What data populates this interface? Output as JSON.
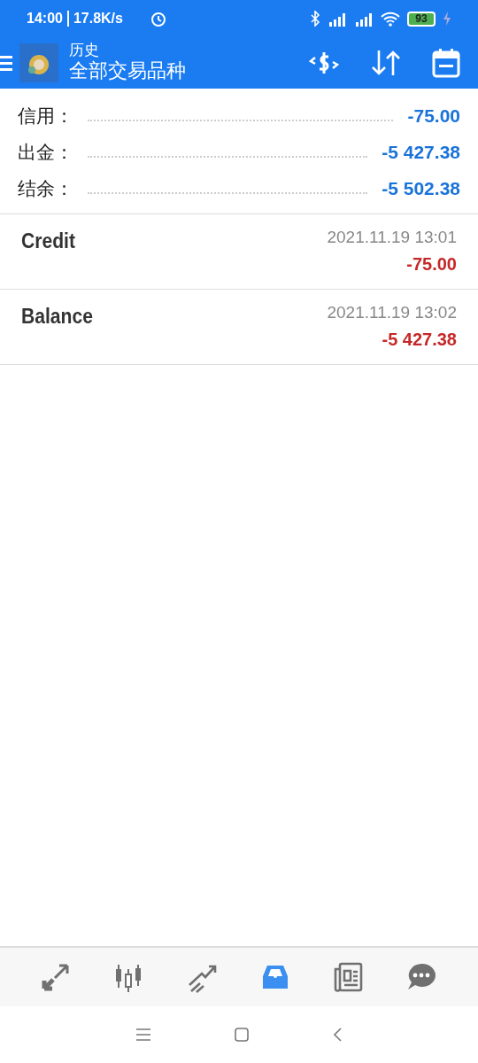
{
  "status_bar": {
    "time": "14:00",
    "speed": "17.8K/s",
    "battery": "93"
  },
  "toolbar": {
    "title": "历史",
    "subtitle": "全部交易品种"
  },
  "summary": [
    {
      "label": "信用：",
      "value": "-75.00"
    },
    {
      "label": "出金：",
      "value": "-5 427.38"
    },
    {
      "label": "结余：",
      "value": "-5 502.38"
    }
  ],
  "deals": [
    {
      "type": "Credit",
      "time": "2021.11.19 13:01",
      "amount": "-75.00"
    },
    {
      "type": "Balance",
      "time": "2021.11.19 13:02",
      "amount": "-5 427.38"
    }
  ],
  "bottom_tabs": [
    {
      "kind": "trade",
      "selected": false
    },
    {
      "kind": "chart",
      "selected": false
    },
    {
      "kind": "trend",
      "selected": false
    },
    {
      "kind": "history",
      "selected": true
    },
    {
      "kind": "news",
      "selected": false
    },
    {
      "kind": "chat",
      "selected": false
    }
  ]
}
